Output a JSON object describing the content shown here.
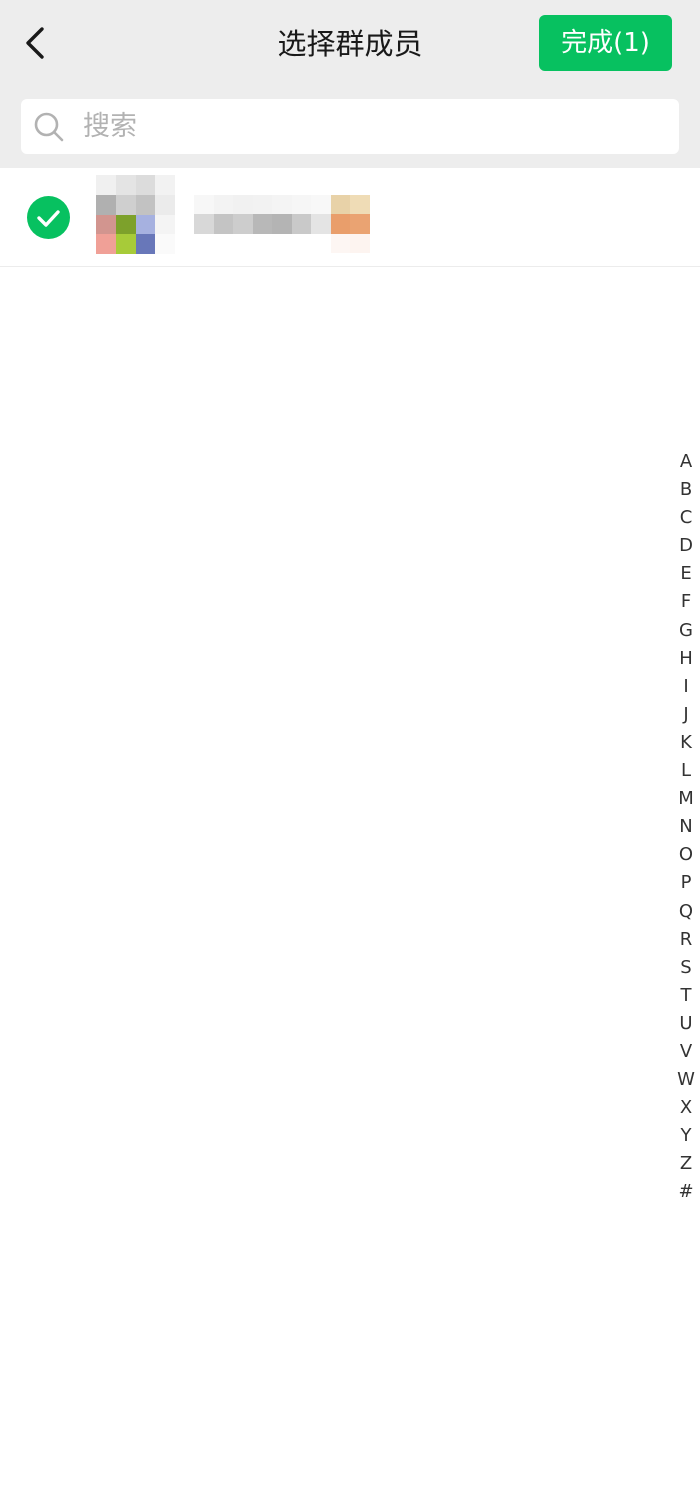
{
  "header": {
    "title": "选择群成员",
    "done_label": "完成(1)"
  },
  "search": {
    "placeholder": "搜索"
  },
  "index_letters": [
    "A",
    "B",
    "C",
    "D",
    "E",
    "F",
    "G",
    "H",
    "I",
    "J",
    "K",
    "L",
    "M",
    "N",
    "O",
    "P",
    "Q",
    "R",
    "S",
    "T",
    "U",
    "V",
    "W",
    "X",
    "Y",
    "Z",
    "#"
  ],
  "colors": {
    "accent": "#07c160",
    "header_bg": "#ededed",
    "title_text": "#191919",
    "placeholder_text": "#b2b2b2"
  }
}
